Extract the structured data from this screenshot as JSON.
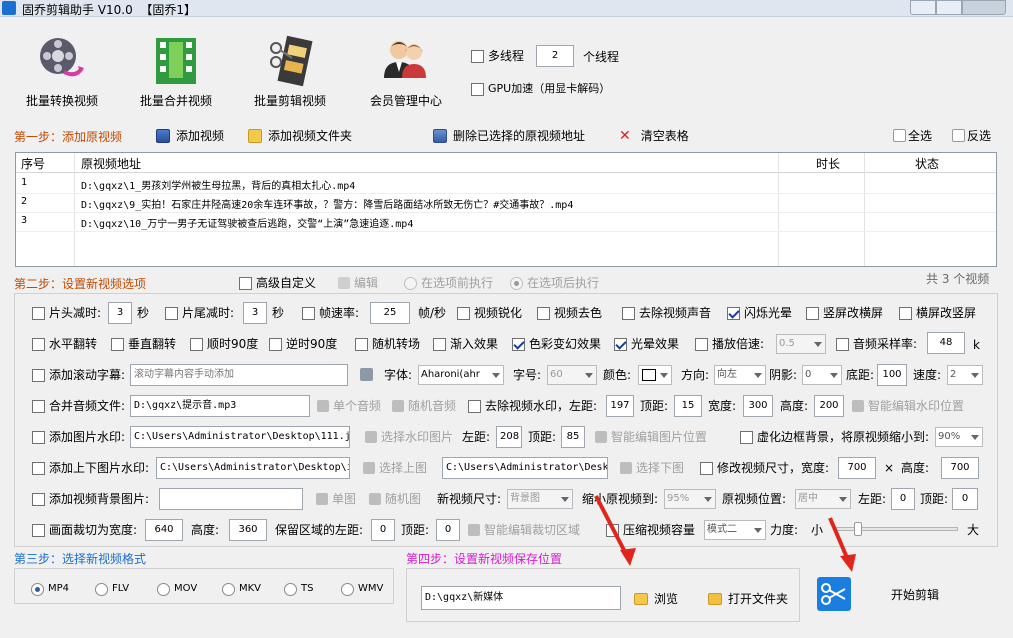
{
  "window": {
    "title": "固乔剪辑助手 V10.0  【固乔1】"
  },
  "top_buttons": [
    {
      "label": "批量转换视频",
      "icon": "film-reel-convert-icon"
    },
    {
      "label": "批量合并视频",
      "icon": "green-film-merge-icon"
    },
    {
      "label": "批量剪辑视频",
      "icon": "film-strip-cut-icon"
    },
    {
      "label": "会员管理中心",
      "icon": "members-icon"
    }
  ],
  "thread": {
    "multi_label": "多线程",
    "count": "2",
    "unit": "个线程",
    "gpu_label": "GPU加速（用显卡解码）"
  },
  "step1": {
    "title": "第一步：添加原视频",
    "add_video": "添加视频",
    "add_folder": "添加视频文件夹",
    "delete_selected": "删除已选择的原视频地址",
    "clear_table": "清空表格",
    "select_all": "全选",
    "invert": "反选"
  },
  "table": {
    "columns": [
      "序号",
      "原视频地址",
      "时长",
      "状态"
    ],
    "rows": [
      {
        "no": "1",
        "path": "D:\\gqxz\\1_男孩刘学州被生母拉黑，背后的真相太扎心.mp4",
        "dur": "",
        "status": ""
      },
      {
        "no": "2",
        "path": "D:\\gqxz\\9_实拍！石家庄井陉高速20余车连环事故，？警方：降雪后路面结冰所致无伤亡？#交通事故？.mp4",
        "dur": "",
        "status": ""
      },
      {
        "no": "3",
        "path": "D:\\gqxz\\10_万宁一男子无证驾驶被查后逃跑，交警“上演”急速追逐.mp4",
        "dur": "",
        "status": ""
      }
    ]
  },
  "step2": {
    "title": "第二步：设置新视频选项",
    "advanced": "高级自定义",
    "edit": "编辑",
    "before": "在选项前执行",
    "after": "在选项后执行",
    "total": "共 3 个视频"
  },
  "opts": {
    "head_cut": "片头减时:",
    "head_val": "3",
    "sec": "秒",
    "tail_cut": "片尾减时:",
    "tail_val": "3",
    "fps": "帧速率:",
    "fps_val": "25",
    "fps_unit": "帧/秒",
    "sharpen": "视频锐化",
    "decolor": "视频去色",
    "remove_audio": "去除视频声音",
    "flash": "闪烁光晕",
    "v2h": "竖屏改横屏",
    "h2v": "横屏改竖屏",
    "hflip": "水平翻转",
    "vflip": "垂直翻转",
    "cw90": "顺时90度",
    "ccw90": "逆时90度",
    "rand_trans": "随机转场",
    "fade_in": "渐入效果",
    "color_fx": "色彩变幻效果",
    "halo": "光晕效果",
    "speed": "播放倍速:",
    "speed_val": "0.5",
    "samplerate": "音频采样率:",
    "samplerate_val": "48",
    "k": "k",
    "scroll_sub": "添加滚动字幕:",
    "scroll_placeholder": "滚动字幕内容手动添加",
    "font": "字体:",
    "font_val": "Aharoni(ahr",
    "size": "字号:",
    "size_val": "60",
    "color": "颜色:",
    "direction": "方向:",
    "direction_val": "向左",
    "shadow": "阴影:",
    "shadow_val": "0",
    "bottom": "底距:",
    "bottom_val": "100",
    "speed2": "速度:",
    "speed2_val": "2",
    "merge_audio": "合并音频文件:",
    "merge_audio_val": "D:\\gqxz\\提示音.mp3",
    "single_audio": "单个音频",
    "rand_audio": "随机音频",
    "remove_wm": "去除视频水印，左距:",
    "wm_left": "197",
    "top_dist": "顶距:",
    "wm_top": "15",
    "width": "宽度:",
    "wm_w": "300",
    "height": "高度:",
    "wm_h": "200",
    "smart_wm": "智能编辑水印位置",
    "img_wm": "添加图片水印:",
    "img_wm_val": "C:\\Users\\Administrator\\Desktop\\111.j",
    "choose_wm": "选择水印图片",
    "left_dist": "左距:",
    "img_left": "208",
    "img_top": "85",
    "smart_img": "智能编辑图片位置",
    "blur_bg": "虚化边框背景，将原视频缩小到:",
    "blur_val": "90%",
    "updown": "添加上下图片水印:",
    "up_val": "C:\\Users\\Administrator\\Desktop\\i",
    "choose_up": "选择上图",
    "down_val": "C:\\Users\\Administrator\\Desk",
    "choose_down": "选择下图",
    "resize": "修改视频尺寸，宽度:",
    "resize_w": "700",
    "times": "×",
    "height2": "高度:",
    "resize_h": "700",
    "bg_img": "添加视频背景图片:",
    "single_img": "单图",
    "rand_img": "随机图",
    "new_size": "新视频尺寸:",
    "new_size_val": "背景图",
    "shrink": "缩小原视频到:",
    "shrink_val": "95%",
    "position": "原视频位置:",
    "position_val": "居中",
    "pos_left": "0",
    "pos_top": "0",
    "crop": "画面裁切为宽度:",
    "crop_w": "640",
    "crop_h_label": "高度:",
    "crop_h": "360",
    "keep_left": "保留区域的左距:",
    "keep_left_val": "0",
    "keep_top_val": "0",
    "smart_crop": "智能编辑裁切区域",
    "compress": "压缩视频容量",
    "compress_val": "模式二",
    "strength": "力度:",
    "small": "小",
    "big": "大"
  },
  "slider": {
    "level": 0.15
  },
  "step3": {
    "title": "第三步：选择新视频格式",
    "formats": [
      "MP4",
      "FLV",
      "MOV",
      "MKV",
      "TS",
      "WMV"
    ],
    "selected": "MP4"
  },
  "step4": {
    "title": "第四步：设置新视频保存位置",
    "path": "D:\\gqxz\\新媒体",
    "browse": "浏览",
    "open_folder": "打开文件夹"
  },
  "start": {
    "label": "开始剪辑"
  },
  "colors": {
    "accent": "#1a6fd1",
    "step_orange": "#c24a00",
    "step4_magenta": "#d61bd0",
    "arrow_red": "#e0251c"
  }
}
